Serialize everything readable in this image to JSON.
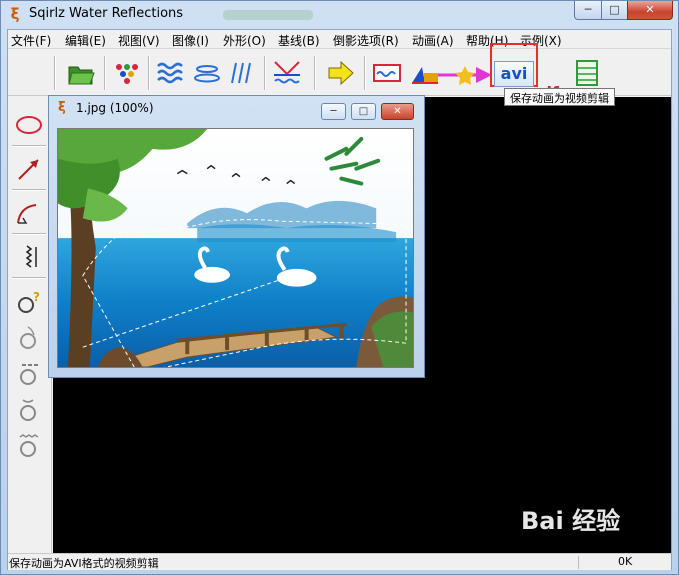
{
  "window": {
    "title": "Sqirlz Water Reflections"
  },
  "menu": [
    "文件(F)",
    "编辑(E)",
    "视图(V)",
    "图像(I)",
    "外形(O)",
    "基线(B)",
    "倒影选项(R)",
    "动画(A)",
    "帮助(H)",
    "示例(X)"
  ],
  "toolbar": {
    "avi_label": "avi",
    "gif_label": "gif",
    "tooltip": "保存动画为视频剪辑"
  },
  "child_window": {
    "title": "1.jpg  (100%)"
  },
  "statusbar": {
    "text": "保存动画为AVI格式的视频剪辑",
    "ok": "0K"
  },
  "watermark": {
    "text": "Bai 经验"
  },
  "colors": {
    "highlight": "#e53030",
    "workspace": "#000000",
    "avi": "#1a4fc9",
    "gif": "#d7263d"
  }
}
